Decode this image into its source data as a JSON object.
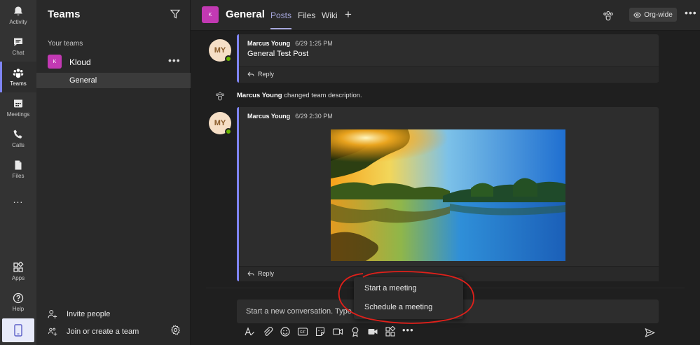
{
  "rail": {
    "items": [
      {
        "label": "Activity",
        "icon": "bell-icon"
      },
      {
        "label": "Chat",
        "icon": "chat-icon"
      },
      {
        "label": "Teams",
        "icon": "teams-icon",
        "active": true
      },
      {
        "label": "Meetings",
        "icon": "calendar-icon"
      },
      {
        "label": "Calls",
        "icon": "phone-icon"
      },
      {
        "label": "Files",
        "icon": "file-icon"
      },
      {
        "label": "...",
        "icon": "more-icon"
      }
    ],
    "bottom": [
      {
        "label": "Apps",
        "icon": "apps-icon"
      },
      {
        "label": "Help",
        "icon": "help-icon"
      }
    ]
  },
  "teams_panel": {
    "title": "Teams",
    "section_label": "Your teams",
    "team": {
      "initial": "K",
      "name": "Kloud"
    },
    "channel": "General",
    "invite_label": "Invite people",
    "join_label": "Join or create a team"
  },
  "header": {
    "channel_initial": "K",
    "channel_title": "General",
    "tabs": [
      "Posts",
      "Files",
      "Wiki"
    ],
    "active_tab": "Posts",
    "org_wide_label": "Org-wide"
  },
  "posts": [
    {
      "avatar": "MY",
      "author": "Marcus Young",
      "time": "6/29 1:25 PM",
      "body": "General Test Post",
      "reply_label": "Reply"
    },
    {
      "avatar": "MY",
      "author": "Marcus Young",
      "time": "6/29 2:30 PM",
      "body": "",
      "has_image": true,
      "reply_label": "Reply"
    }
  ],
  "system_message": {
    "author": "Marcus Young",
    "text": " changed team description."
  },
  "compose": {
    "placeholder": "Start a new conversation. Type @"
  },
  "popup_menu": {
    "items": [
      "Start a meeting",
      "Schedule a meeting"
    ]
  },
  "colors": {
    "accent": "#7f85f5",
    "team_avatar": "#c239b3",
    "presence_available": "#6bb700",
    "annotation_red": "#e0201a"
  }
}
